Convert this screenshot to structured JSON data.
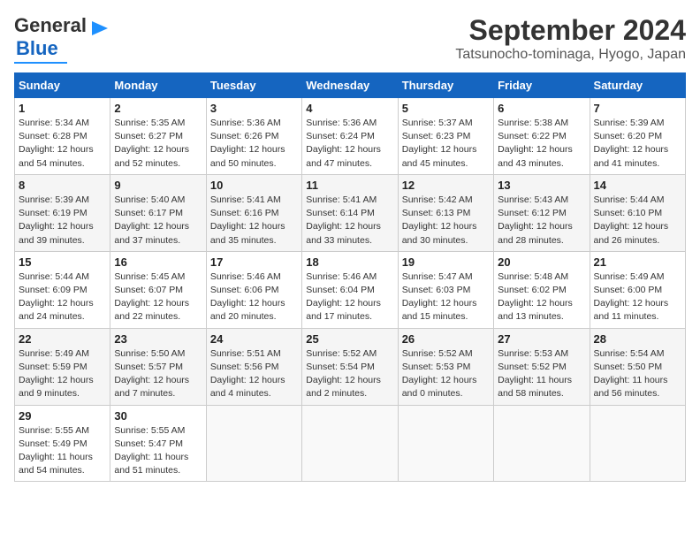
{
  "header": {
    "logo_line1": "General",
    "logo_line2": "Blue",
    "title": "September 2024",
    "subtitle": "Tatsunocho-tominaga, Hyogo, Japan"
  },
  "weekdays": [
    "Sunday",
    "Monday",
    "Tuesday",
    "Wednesday",
    "Thursday",
    "Friday",
    "Saturday"
  ],
  "weeks": [
    [
      {
        "day": "1",
        "info": "Sunrise: 5:34 AM\nSunset: 6:28 PM\nDaylight: 12 hours\nand 54 minutes."
      },
      {
        "day": "2",
        "info": "Sunrise: 5:35 AM\nSunset: 6:27 PM\nDaylight: 12 hours\nand 52 minutes."
      },
      {
        "day": "3",
        "info": "Sunrise: 5:36 AM\nSunset: 6:26 PM\nDaylight: 12 hours\nand 50 minutes."
      },
      {
        "day": "4",
        "info": "Sunrise: 5:36 AM\nSunset: 6:24 PM\nDaylight: 12 hours\nand 47 minutes."
      },
      {
        "day": "5",
        "info": "Sunrise: 5:37 AM\nSunset: 6:23 PM\nDaylight: 12 hours\nand 45 minutes."
      },
      {
        "day": "6",
        "info": "Sunrise: 5:38 AM\nSunset: 6:22 PM\nDaylight: 12 hours\nand 43 minutes."
      },
      {
        "day": "7",
        "info": "Sunrise: 5:39 AM\nSunset: 6:20 PM\nDaylight: 12 hours\nand 41 minutes."
      }
    ],
    [
      {
        "day": "8",
        "info": "Sunrise: 5:39 AM\nSunset: 6:19 PM\nDaylight: 12 hours\nand 39 minutes."
      },
      {
        "day": "9",
        "info": "Sunrise: 5:40 AM\nSunset: 6:17 PM\nDaylight: 12 hours\nand 37 minutes."
      },
      {
        "day": "10",
        "info": "Sunrise: 5:41 AM\nSunset: 6:16 PM\nDaylight: 12 hours\nand 35 minutes."
      },
      {
        "day": "11",
        "info": "Sunrise: 5:41 AM\nSunset: 6:14 PM\nDaylight: 12 hours\nand 33 minutes."
      },
      {
        "day": "12",
        "info": "Sunrise: 5:42 AM\nSunset: 6:13 PM\nDaylight: 12 hours\nand 30 minutes."
      },
      {
        "day": "13",
        "info": "Sunrise: 5:43 AM\nSunset: 6:12 PM\nDaylight: 12 hours\nand 28 minutes."
      },
      {
        "day": "14",
        "info": "Sunrise: 5:44 AM\nSunset: 6:10 PM\nDaylight: 12 hours\nand 26 minutes."
      }
    ],
    [
      {
        "day": "15",
        "info": "Sunrise: 5:44 AM\nSunset: 6:09 PM\nDaylight: 12 hours\nand 24 minutes."
      },
      {
        "day": "16",
        "info": "Sunrise: 5:45 AM\nSunset: 6:07 PM\nDaylight: 12 hours\nand 22 minutes."
      },
      {
        "day": "17",
        "info": "Sunrise: 5:46 AM\nSunset: 6:06 PM\nDaylight: 12 hours\nand 20 minutes."
      },
      {
        "day": "18",
        "info": "Sunrise: 5:46 AM\nSunset: 6:04 PM\nDaylight: 12 hours\nand 17 minutes."
      },
      {
        "day": "19",
        "info": "Sunrise: 5:47 AM\nSunset: 6:03 PM\nDaylight: 12 hours\nand 15 minutes."
      },
      {
        "day": "20",
        "info": "Sunrise: 5:48 AM\nSunset: 6:02 PM\nDaylight: 12 hours\nand 13 minutes."
      },
      {
        "day": "21",
        "info": "Sunrise: 5:49 AM\nSunset: 6:00 PM\nDaylight: 12 hours\nand 11 minutes."
      }
    ],
    [
      {
        "day": "22",
        "info": "Sunrise: 5:49 AM\nSunset: 5:59 PM\nDaylight: 12 hours\nand 9 minutes."
      },
      {
        "day": "23",
        "info": "Sunrise: 5:50 AM\nSunset: 5:57 PM\nDaylight: 12 hours\nand 7 minutes."
      },
      {
        "day": "24",
        "info": "Sunrise: 5:51 AM\nSunset: 5:56 PM\nDaylight: 12 hours\nand 4 minutes."
      },
      {
        "day": "25",
        "info": "Sunrise: 5:52 AM\nSunset: 5:54 PM\nDaylight: 12 hours\nand 2 minutes."
      },
      {
        "day": "26",
        "info": "Sunrise: 5:52 AM\nSunset: 5:53 PM\nDaylight: 12 hours\nand 0 minutes."
      },
      {
        "day": "27",
        "info": "Sunrise: 5:53 AM\nSunset: 5:52 PM\nDaylight: 11 hours\nand 58 minutes."
      },
      {
        "day": "28",
        "info": "Sunrise: 5:54 AM\nSunset: 5:50 PM\nDaylight: 11 hours\nand 56 minutes."
      }
    ],
    [
      {
        "day": "29",
        "info": "Sunrise: 5:55 AM\nSunset: 5:49 PM\nDaylight: 11 hours\nand 54 minutes."
      },
      {
        "day": "30",
        "info": "Sunrise: 5:55 AM\nSunset: 5:47 PM\nDaylight: 11 hours\nand 51 minutes."
      },
      {
        "day": "",
        "info": ""
      },
      {
        "day": "",
        "info": ""
      },
      {
        "day": "",
        "info": ""
      },
      {
        "day": "",
        "info": ""
      },
      {
        "day": "",
        "info": ""
      }
    ]
  ]
}
